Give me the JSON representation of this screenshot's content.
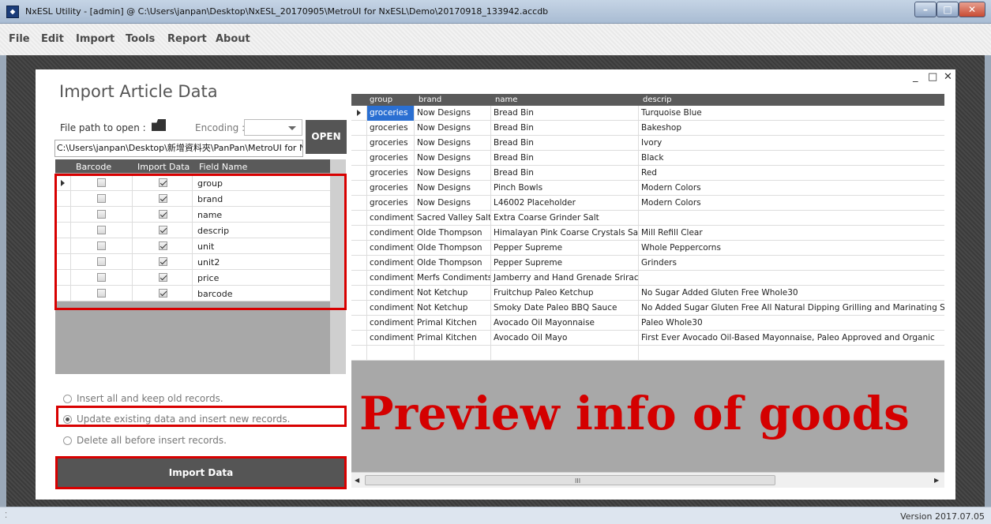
{
  "window": {
    "title": "NxESL Utility - [admin] @ C:\\Users\\janpan\\Desktop\\NxESL_20170905\\MetroUI for NxESL\\Demo\\20170918_133942.accdb"
  },
  "menu": [
    "File",
    "Edit",
    "Import",
    "Tools",
    "Report",
    "About"
  ],
  "panel": {
    "title": "Import Article Data",
    "min_icon": "_",
    "max_icon": "□",
    "close_icon": "✕"
  },
  "file": {
    "path_label": "File path to open :",
    "encoding_label": "Encoding :",
    "open_label": "OPEN",
    "path_value": "C:\\Users\\janpan\\Desktop\\新增資料夾\\PanPan\\MetroUI for NxESL"
  },
  "field_grid": {
    "headers": [
      "Barcode",
      "Import Data",
      "Field Name"
    ],
    "rows": [
      {
        "barcode": false,
        "import": true,
        "field": "group"
      },
      {
        "barcode": false,
        "import": true,
        "field": "brand"
      },
      {
        "barcode": false,
        "import": true,
        "field": "name"
      },
      {
        "barcode": false,
        "import": true,
        "field": "descrip"
      },
      {
        "barcode": false,
        "import": true,
        "field": "unit"
      },
      {
        "barcode": false,
        "import": true,
        "field": "unit2"
      },
      {
        "barcode": false,
        "import": true,
        "field": "price"
      },
      {
        "barcode": false,
        "import": true,
        "field": "barcode"
      }
    ]
  },
  "options": {
    "insert_keep": "Insert all and keep old records.",
    "update_insert": "Update existing data and insert new records.",
    "delete_insert": "Delete all before insert records.",
    "selected": "update_insert"
  },
  "import_button": "Import Data",
  "preview_grid": {
    "headers": [
      "group",
      "brand",
      "name",
      "descrip"
    ],
    "rows": [
      [
        "groceries",
        "Now Designs",
        "Bread Bin",
        "Turquoise Blue"
      ],
      [
        "groceries",
        "Now Designs",
        "Bread Bin",
        "Bakeshop"
      ],
      [
        "groceries",
        "Now Designs",
        "Bread Bin",
        "Ivory"
      ],
      [
        "groceries",
        "Now Designs",
        "Bread Bin",
        "Black"
      ],
      [
        "groceries",
        "Now Designs",
        "Bread Bin",
        "Red"
      ],
      [
        "groceries",
        "Now Designs",
        "Pinch Bowls",
        "Modern Colors"
      ],
      [
        "groceries",
        "Now Designs",
        "L46002 Placeholder",
        "Modern Colors"
      ],
      [
        "condiment",
        "Sacred Valley Salt",
        "Extra Coarse Grinder Salt",
        ""
      ],
      [
        "condiment",
        "Olde Thompson",
        "Himalayan Pink Coarse Crystals Salt",
        "Mill Refill Clear"
      ],
      [
        "condiment",
        "Olde Thompson",
        "Pepper Supreme",
        "Whole Peppercorns"
      ],
      [
        "condiment",
        "Olde Thompson",
        "Pepper Supreme",
        "Grinders"
      ],
      [
        "condiment",
        "Merfs Condiments",
        "Jamberry and Hand Grenade Sriracha",
        ""
      ],
      [
        "condiment",
        "Not Ketchup",
        "Fruitchup Paleo Ketchup",
        "No Sugar Added Gluten Free Whole30"
      ],
      [
        "condiment",
        "Not Ketchup",
        "Smoky Date Paleo BBQ Sauce",
        "No Added Sugar Gluten Free All Natural Dipping Grilling and Marinating Sauce"
      ],
      [
        "condiment",
        "Primal Kitchen",
        "Avocado Oil Mayonnaise",
        "Paleo Whole30"
      ],
      [
        "condiment",
        "Primal Kitchen",
        "Avocado Oil Mayo",
        "First Ever Avocado Oil-Based Mayonnaise, Paleo Approved and Organic"
      ]
    ]
  },
  "scroll_grip": "III",
  "preview_caption": "Preview info of goods",
  "version": "Version 2017.07.05",
  "status_grip": "⁚",
  "icons": [
    "app-icon",
    "folder-icon",
    "dropdown-arrow-icon",
    "row-pointer-icon",
    "minimize-icon",
    "maximize-icon",
    "close-icon"
  ],
  "colors": {
    "highlight": "#2a6fd2",
    "annotation_red": "#d80000",
    "button_dark": "#555555"
  }
}
